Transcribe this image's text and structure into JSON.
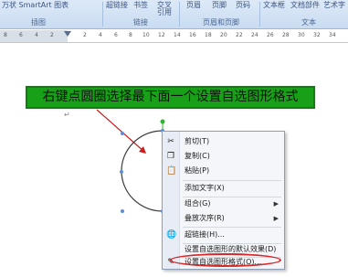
{
  "ribbon": {
    "top_row": [
      {
        "id": "smartart",
        "label": "万状  SmartArt  图表"
      },
      {
        "id": "hyperlink",
        "label": "超链接"
      },
      {
        "id": "bookmark",
        "label": "书签"
      },
      {
        "id": "crossref",
        "label": "交叉"
      },
      {
        "id": "header",
        "label": "页眉"
      },
      {
        "id": "footer",
        "label": "页脚"
      },
      {
        "id": "pagenum",
        "label": "页码"
      },
      {
        "id": "textbox",
        "label": "文本框"
      },
      {
        "id": "quickparts",
        "label": "文档部件"
      },
      {
        "id": "wordart",
        "label": "艺术字"
      },
      {
        "id": "dropcap",
        "label": "首字下沉"
      }
    ],
    "crossref_line2": "引用",
    "groups": [
      {
        "id": "illustrations",
        "label": "插图"
      },
      {
        "id": "links",
        "label": "链接"
      },
      {
        "id": "header_footer",
        "label": "页眉和页脚"
      },
      {
        "id": "text",
        "label": "文本"
      }
    ]
  },
  "ruler": {
    "numbers": [
      "8",
      "6",
      "4",
      "2",
      "2",
      "4",
      "6",
      "8",
      "10",
      "12",
      "14",
      "16",
      "18",
      "20",
      "22",
      "24",
      "26",
      "28",
      "30",
      "32",
      "34",
      "36"
    ]
  },
  "note": {
    "text": "右键点圆圈选择最下面一个设置自选图形格式",
    "color": "#18a018"
  },
  "document": {
    "paragraph_mark": "↵"
  },
  "context_menu": {
    "items": [
      {
        "label": "剪切(T)",
        "icon": "scissors-icon",
        "glyph": "✂"
      },
      {
        "label": "复制(C)",
        "icon": "copy-icon",
        "glyph": "❐"
      },
      {
        "label": "粘贴(P)",
        "icon": "paste-icon",
        "glyph": "📋"
      },
      {
        "label": "添加文字(X)",
        "icon": "",
        "glyph": ""
      },
      {
        "label": "组合(G)",
        "icon": "",
        "glyph": "",
        "submenu": true
      },
      {
        "label": "叠放次序(R)",
        "icon": "",
        "glyph": "",
        "submenu": true
      },
      {
        "label": "超链接(H)...",
        "icon": "hyperlink-icon",
        "glyph": "🌐"
      },
      {
        "label": "设置自选图形的默认效果(D)",
        "icon": "",
        "glyph": ""
      },
      {
        "label": "设置自选图形格式(O)...",
        "icon": "format-shape-icon",
        "glyph": "✎"
      }
    ],
    "submenu_arrow": "▶",
    "highlight_color": "#d42a2a"
  }
}
